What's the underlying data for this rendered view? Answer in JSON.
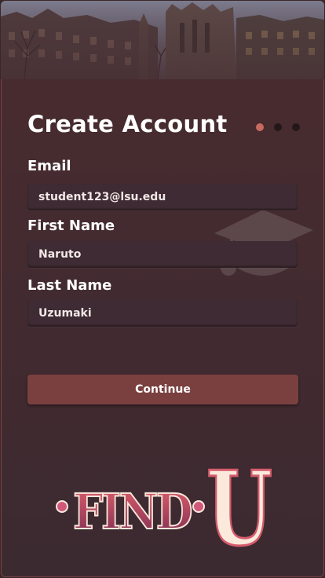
{
  "header": {
    "title": "Create Account",
    "steps_total": 3,
    "steps_current": 1
  },
  "form": {
    "email": {
      "label": "Email",
      "value": "student123@lsu.edu"
    },
    "first_name": {
      "label": "First Name",
      "value": "Naruto"
    },
    "last_name": {
      "label": "Last Name",
      "value": "Uzumaki"
    }
  },
  "actions": {
    "continue_label": "Continue"
  },
  "logo": {
    "word1": "FIND",
    "word2": "U"
  },
  "colors": {
    "background": "#432b30",
    "accent": "#7a403f",
    "active_dot": "#c86a5f",
    "inactive_dot": "#24171a",
    "input_bg": "#3e2b33",
    "logo_pink": "#d45b6c",
    "logo_cream": "#fbe9dc"
  },
  "icons": {
    "watermark": "graduation-cap-icon"
  }
}
